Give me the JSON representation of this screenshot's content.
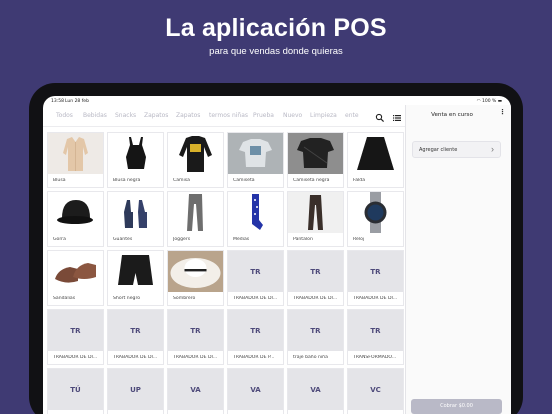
{
  "header": {
    "title": "La aplicación POS",
    "subtitle": "para que vendas donde quieras"
  },
  "status_bar": {
    "time": "13:58",
    "date": "Lun 28 feb",
    "battery": "100 %"
  },
  "tabs": [
    {
      "label": "Todos",
      "active": true
    },
    {
      "label": "Bebidas",
      "active": false
    },
    {
      "label": "Snacks",
      "active": false
    },
    {
      "label": "Zapatos",
      "active": false
    },
    {
      "label": "Zapatos",
      "active": false
    },
    {
      "label": "termos niñas",
      "active": false
    },
    {
      "label": "Prueba",
      "active": false
    },
    {
      "label": "Nuevo",
      "active": false
    },
    {
      "label": "Limpieza",
      "active": false
    },
    {
      "label": "ente",
      "active": false
    }
  ],
  "toolbar_icons": [
    "search-icon",
    "list-icon"
  ],
  "products": [
    {
      "name": "Blusa",
      "image": "blouse"
    },
    {
      "name": "Blusa negra",
      "image": "black-top"
    },
    {
      "name": "Camisa",
      "image": "black-sweatshirt"
    },
    {
      "name": "Camiseta",
      "image": "grey-tshirt"
    },
    {
      "name": "Camiseta negra",
      "image": "black-tshirt"
    },
    {
      "name": "Falda",
      "image": "black-skirt"
    },
    {
      "name": "Gorra",
      "image": "cap"
    },
    {
      "name": "Guantes",
      "image": "gloves"
    },
    {
      "name": "Joggers",
      "image": "joggers"
    },
    {
      "name": "Medias",
      "image": "socks"
    },
    {
      "name": "Pantalon",
      "image": "pants"
    },
    {
      "name": "Reloj",
      "image": "watch"
    },
    {
      "name": "Sandalias",
      "image": "sandals"
    },
    {
      "name": "Short negro",
      "image": "shorts"
    },
    {
      "name": "Sombrero",
      "image": "hat"
    },
    {
      "name": "TRABADOR DE DI...",
      "initials": "TR"
    },
    {
      "name": "TRABADOR DE DI...",
      "initials": "TR"
    },
    {
      "name": "TRABADOR DE DI...",
      "initials": "TR"
    },
    {
      "name": "TRABADOR DE DI...",
      "initials": "TR"
    },
    {
      "name": "TRABADOR DE DI...",
      "initials": "TR"
    },
    {
      "name": "TRABADOR DE DI...",
      "initials": "TR"
    },
    {
      "name": "TRABADOR DE P...",
      "initials": "TR"
    },
    {
      "name": "traje baño niña",
      "initials": "TR"
    },
    {
      "name": "TRANSFORMADO...",
      "initials": "TR"
    },
    {
      "name": "",
      "initials": "TÚ"
    },
    {
      "name": "",
      "initials": "UP"
    },
    {
      "name": "",
      "initials": "VA"
    },
    {
      "name": "",
      "initials": "VA"
    },
    {
      "name": "",
      "initials": "VA"
    },
    {
      "name": "",
      "initials": "VC"
    }
  ],
  "sale_panel": {
    "title": "Venta en curso",
    "more_icon": "more-vertical-icon",
    "add_client_label": "Agregar cliente",
    "charge_label": "Cobrar $0.00"
  },
  "colors": {
    "background": "#3f3a73",
    "active_tab": "#3f3a73",
    "placeholder_tile": "#e4e4e8",
    "charge_button": "#b9b9c7"
  }
}
